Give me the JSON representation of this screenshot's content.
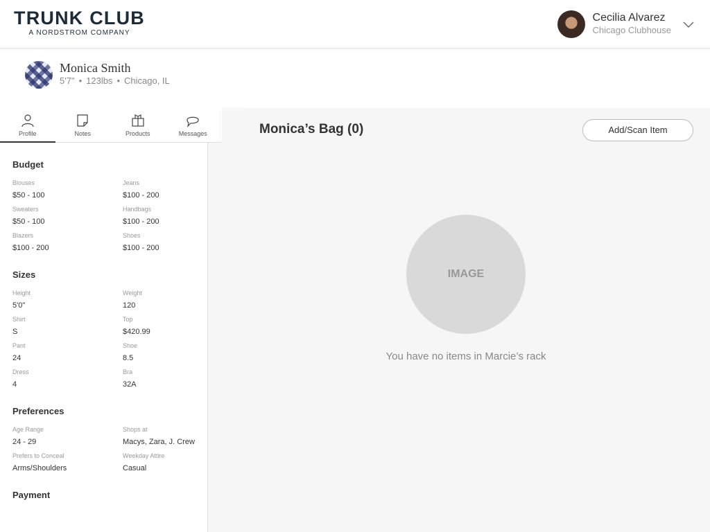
{
  "header": {
    "brand_name": "TRUNK CLUB",
    "brand_sub": "A NORDSTROM COMPANY",
    "user_name": "Cecilia Alvarez",
    "user_location": "Chicago Clubhouse"
  },
  "customer": {
    "name": "Monica Smith",
    "height": "5'7\"",
    "weight": "123lbs",
    "location": "Chicago, IL"
  },
  "tabs": [
    {
      "label": "Profile",
      "icon": "person-icon"
    },
    {
      "label": "Notes",
      "icon": "note-icon"
    },
    {
      "label": "Products",
      "icon": "shirt-box-icon"
    },
    {
      "label": "Messages",
      "icon": "chat-bubble-icon"
    }
  ],
  "profile": {
    "budget": {
      "title": "Budget",
      "fields": [
        {
          "label": "Blouses",
          "value": "$50 - 100"
        },
        {
          "label": "Jeans",
          "value": "$100 - 200"
        },
        {
          "label": "Sweaters",
          "value": "$50 - 100"
        },
        {
          "label": "Handbags",
          "value": "$100 - 200"
        },
        {
          "label": "Blazers",
          "value": "$100 - 200"
        },
        {
          "label": "Shoes",
          "value": "$100 - 200"
        }
      ]
    },
    "sizes": {
      "title": "Sizes",
      "fields": [
        {
          "label": "Height",
          "value": "5'0\""
        },
        {
          "label": "Weight",
          "value": "120"
        },
        {
          "label": "Shirt",
          "value": "S"
        },
        {
          "label": "Top",
          "value": "$420.99"
        },
        {
          "label": "Pant",
          "value": "24"
        },
        {
          "label": "Shoe",
          "value": "8.5"
        },
        {
          "label": "Dress",
          "value": "4"
        },
        {
          "label": "Bra",
          "value": "32A"
        }
      ]
    },
    "preferences": {
      "title": "Preferences",
      "fields": [
        {
          "label": "Age Range",
          "value": "24 - 29"
        },
        {
          "label": "Shops at",
          "value": "Macys, Zara, J. Crew"
        },
        {
          "label": "Prefers to Conceal",
          "value": "Arms/Shoulders"
        },
        {
          "label": "Weekday Attire",
          "value": "Casual"
        }
      ]
    },
    "payment": {
      "title": "Payment"
    }
  },
  "bag": {
    "title": "Monica’s Bag (0)",
    "add_button": "Add/Scan Item",
    "placeholder": "IMAGE",
    "empty_message": "You have no items in Marcie’s rack"
  },
  "colors": {
    "brand": "#1c2b39",
    "placeholder": "#d9d9d9"
  }
}
